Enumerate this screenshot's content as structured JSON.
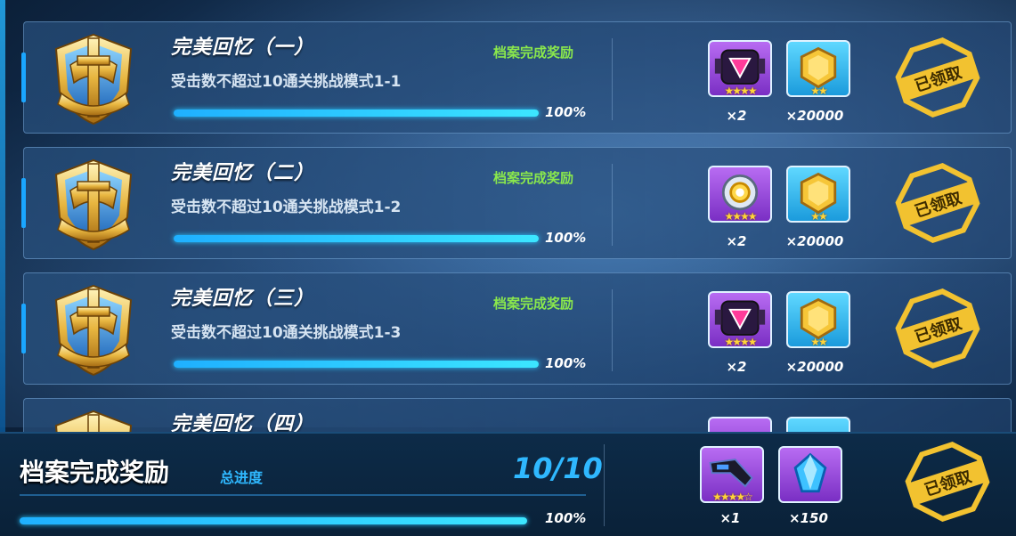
{
  "records": [
    {
      "title": "完美回忆（一）",
      "desc": "受击数不超过10通关挑战模式1-1",
      "tag": "档案完成奖励",
      "progress": 1.0,
      "progress_text": "100%",
      "rewards": [
        {
          "icon": "chip-triangle-icon",
          "color": "purple",
          "stars": "★★★★",
          "qty": "×2"
        },
        {
          "icon": "gold-coin-icon",
          "color": "cyan",
          "stars": "★★",
          "qty": "×20000"
        }
      ],
      "status": "已领取"
    },
    {
      "title": "完美回忆（二）",
      "desc": "受击数不超过10通关挑战模式1-2",
      "tag": "档案完成奖励",
      "progress": 1.0,
      "progress_text": "100%",
      "rewards": [
        {
          "icon": "gear-ring-icon",
          "color": "purple",
          "stars": "★★★★",
          "qty": "×2"
        },
        {
          "icon": "gold-coin-icon",
          "color": "cyan",
          "stars": "★★",
          "qty": "×20000"
        }
      ],
      "status": "已领取"
    },
    {
      "title": "完美回忆（三）",
      "desc": "受击数不超过10通关挑战模式1-3",
      "tag": "档案完成奖励",
      "progress": 1.0,
      "progress_text": "100%",
      "rewards": [
        {
          "icon": "chip-triangle-icon",
          "color": "purple",
          "stars": "★★★★",
          "qty": "×2"
        },
        {
          "icon": "gold-coin-icon",
          "color": "cyan",
          "stars": "★★",
          "qty": "×20000"
        }
      ],
      "status": "已领取"
    },
    {
      "title": "完美回忆（四）"
    }
  ],
  "summary": {
    "title": "档案完成奖励",
    "subtitle": "总进度",
    "count": "10/10",
    "progress": 1.0,
    "progress_text": "100%",
    "rewards": [
      {
        "icon": "gun-weapon-icon",
        "color": "purple",
        "stars": "★★★★☆",
        "qty": "×1"
      },
      {
        "icon": "blue-crystal-icon",
        "color": "purple",
        "qty": "×150"
      }
    ],
    "status": "已领取"
  },
  "colors": {
    "accent": "#2fb8ff",
    "tag": "#8ae84c",
    "gold": "#f2c230"
  }
}
